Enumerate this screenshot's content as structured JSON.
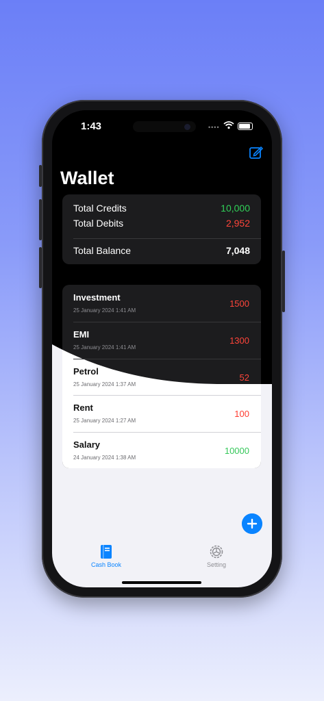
{
  "status_bar": {
    "time": "1:43"
  },
  "header": {
    "title": "Wallet"
  },
  "summary": {
    "credits_label": "Total Credits",
    "credits_value": "10,000",
    "debits_label": "Total Debits",
    "debits_value": "2,952",
    "balance_label": "Total Balance",
    "balance_value": "7,048"
  },
  "transactions": [
    {
      "name": "Investment",
      "date": "25 January 2024 1:41 AM",
      "amount": "1500",
      "type": "debit"
    },
    {
      "name": "EMI",
      "date": "25 January 2024 1:41 AM",
      "amount": "1300",
      "type": "debit"
    },
    {
      "name": "Petrol",
      "date": "25 January 2024 1:37 AM",
      "amount": "52",
      "type": "debit"
    },
    {
      "name": "Rent",
      "date": "25 January 2024 1:27 AM",
      "amount": "100",
      "type": "debit"
    },
    {
      "name": "Salary",
      "date": "24 January 2024 1:38 AM",
      "amount": "10000",
      "type": "credit"
    }
  ],
  "tabs": [
    {
      "label": "Cash Book",
      "icon": "book-icon",
      "active": true
    },
    {
      "label": "Setting",
      "icon": "gear-icon",
      "active": false
    }
  ],
  "colors": {
    "accent": "#0a84ff",
    "credit": "#30d158",
    "debit": "#ff453a",
    "credit_light": "#34c759",
    "debit_light": "#ff3b30"
  }
}
